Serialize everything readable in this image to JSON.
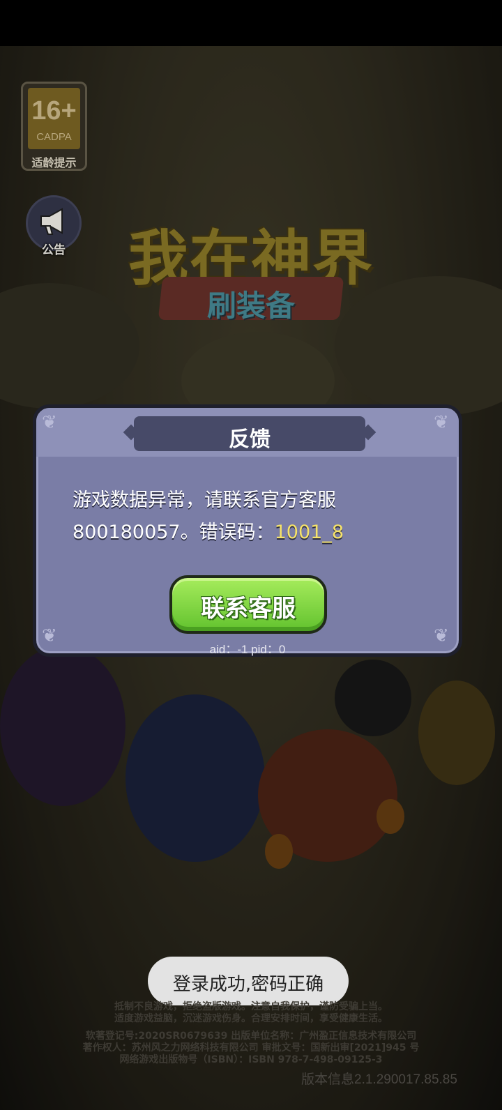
{
  "age_rating": {
    "number": "16+",
    "org": "CADPA",
    "label": "适龄提示"
  },
  "notice": {
    "label": "公告"
  },
  "logo": {
    "title": "我在神界",
    "subtitle": "刷装备"
  },
  "dialog": {
    "title": "反馈",
    "message_line1": "游戏数据异常，请联系官方客服",
    "message_line2_prefix": "800180057。错误码：",
    "error_code": "1001_8",
    "button_label": "联系客服",
    "ids": "aid：-1 pid：0"
  },
  "toast": {
    "text": "登录成功,密码正确"
  },
  "footer": {
    "legal_1": "抵制不良游戏，拒绝盗版游戏。注意自我保护，谨防受骗上当。",
    "legal_2": "适度游戏益脑，沉迷游戏伤身。合理安排时间，享受健康生活。",
    "legal_3": "软著登记号:2020SR0679639 出版单位名称：广州盈正信息技术有限公司",
    "legal_4": "著作权人：苏州风之力网络科技有限公司 审批文号：国新出审[2021]945 号",
    "legal_5": "网络游戏出版物号（ISBN）：ISBN 978-7-498-09125-3",
    "version": "版本信息2.1.290017.85.85"
  },
  "colors": {
    "dialog_bg": "#7a7da6",
    "button_green": "#62c22e",
    "error_code": "#f6e36a"
  }
}
